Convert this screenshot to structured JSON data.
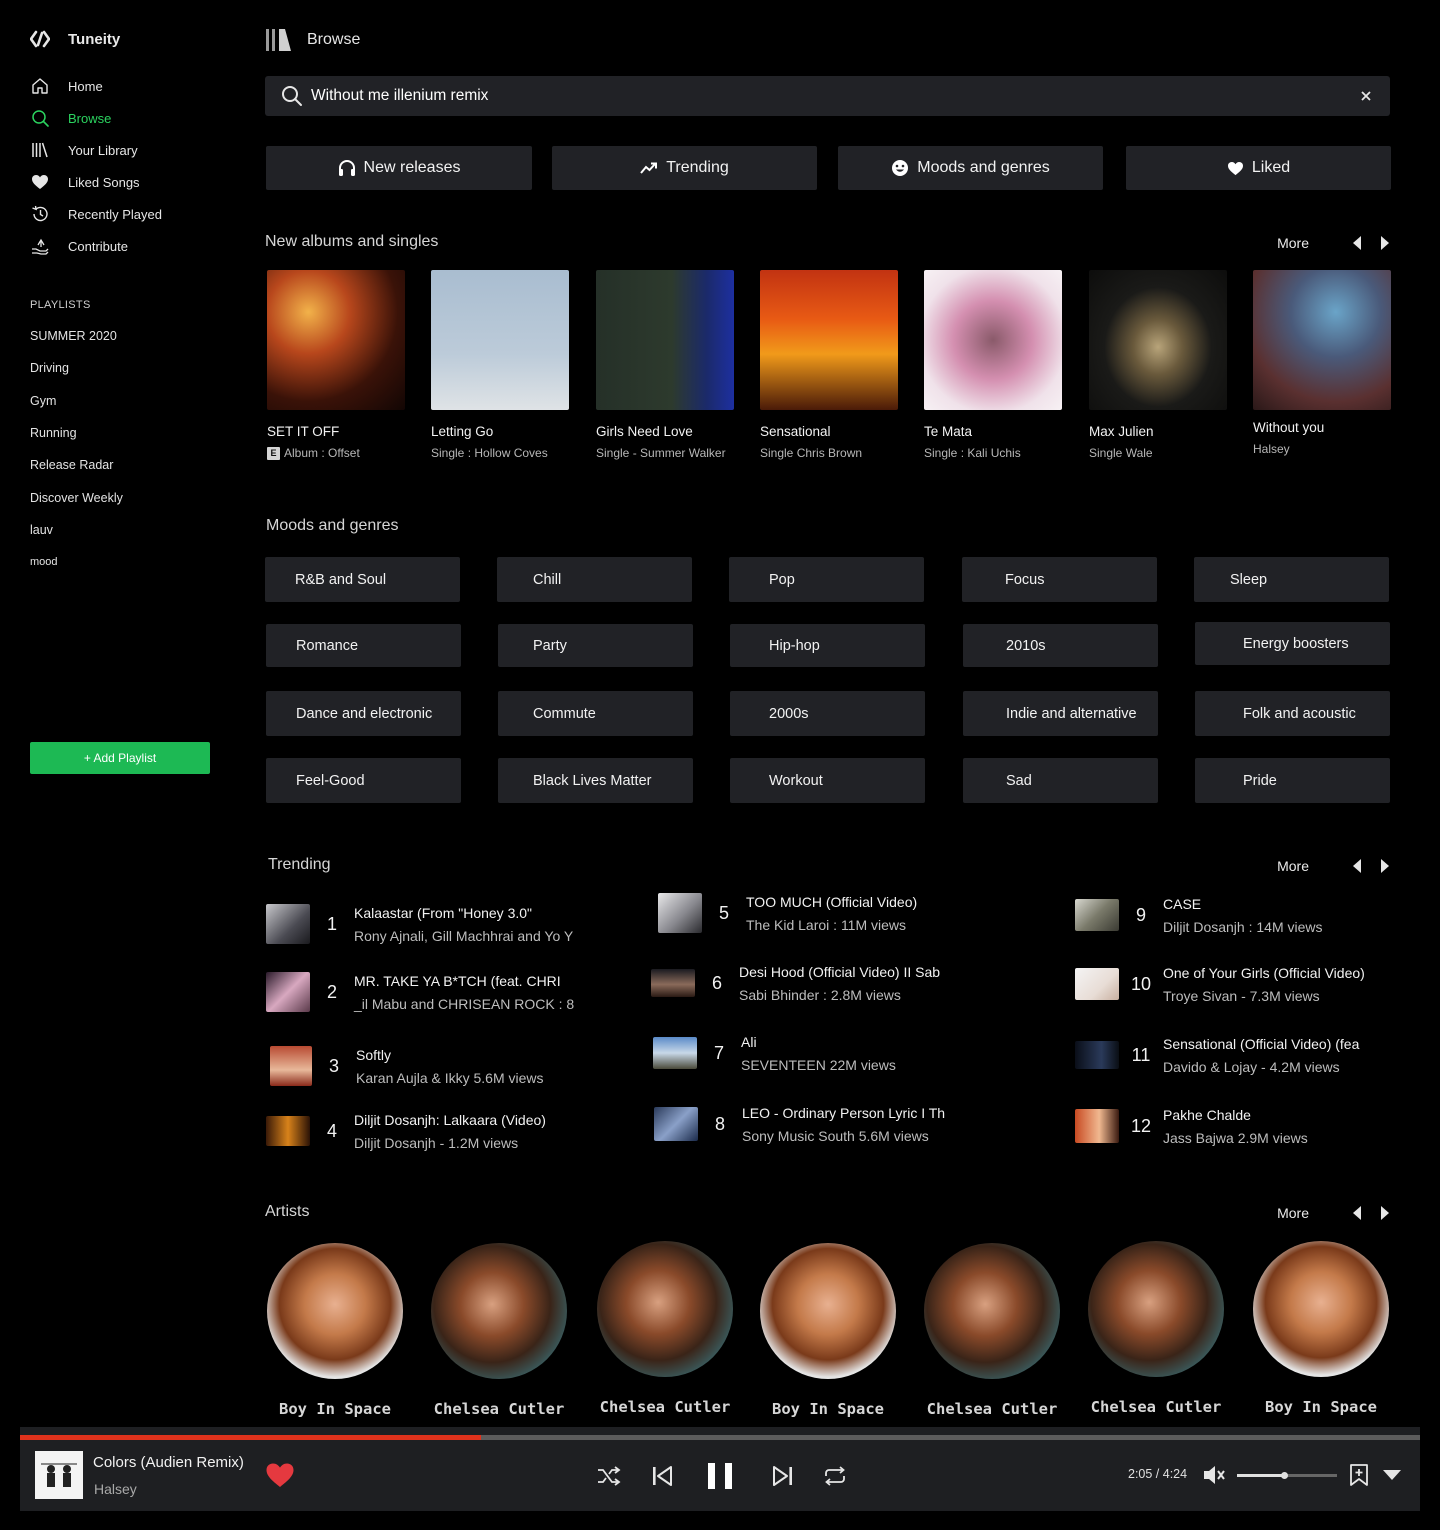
{
  "app": {
    "name": "Tuneity"
  },
  "nav": [
    {
      "label": "Home",
      "icon": "home-icon",
      "active": false
    },
    {
      "label": "Browse",
      "icon": "search-icon",
      "active": true
    },
    {
      "label": "Your Library",
      "icon": "library-icon",
      "active": false
    },
    {
      "label": "Liked Songs",
      "icon": "heart-icon",
      "active": false
    },
    {
      "label": "Recently Played",
      "icon": "history-icon",
      "active": false
    },
    {
      "label": "Contribute",
      "icon": "contribute-icon",
      "active": false
    }
  ],
  "playlists": {
    "heading": "PLAYLISTS",
    "items": [
      "SUMMER 2020",
      "Driving",
      "Gym",
      "Running",
      "Release Radar",
      "Discover Weekly",
      "lauv",
      "mood"
    ],
    "add_label": "+ Add Playlist"
  },
  "page": {
    "title": "Browse"
  },
  "search": {
    "value": "Without me illenium remix"
  },
  "quick_links": [
    {
      "label": "New releases",
      "icon": "headphones-icon"
    },
    {
      "label": "Trending",
      "icon": "trending-icon"
    },
    {
      "label": "Moods and genres",
      "icon": "smiley-icon"
    },
    {
      "label": "Liked",
      "icon": "heart-icon"
    }
  ],
  "new_albums": {
    "title": "New albums and singles",
    "more": "More",
    "items": [
      {
        "name": "SET IT OFF",
        "meta": "Album : Offset",
        "explicit": true
      },
      {
        "name": "Letting Go",
        "meta": "Single : Hollow Coves",
        "explicit": false
      },
      {
        "name": "Girls Need Love",
        "meta": "Single - Summer Walker",
        "explicit": false
      },
      {
        "name": "Sensational",
        "meta": "Single  Chris Brown",
        "explicit": false
      },
      {
        "name": "Te Mata",
        "meta": "Single : Kali Uchis",
        "explicit": false
      },
      {
        "name": "Max Julien",
        "meta": "Single  Wale",
        "explicit": false
      },
      {
        "name": "Without you",
        "meta": "Halsey",
        "explicit": false
      }
    ]
  },
  "moods": {
    "title": "Moods and genres",
    "items": [
      "R&B and Soul",
      "Chill",
      "Pop",
      "Focus",
      "Sleep",
      "Romance",
      "Party",
      "Hip-hop",
      "2010s",
      "Energy boosters",
      "Dance and electronic",
      "Commute",
      "2000s",
      "Indie and alternative",
      "Folk and acoustic",
      "Feel-Good",
      "Black Lives Matter",
      "Workout",
      "Sad",
      "Pride"
    ]
  },
  "trending": {
    "title": "Trending",
    "more": "More",
    "items": [
      {
        "rank": "1",
        "title": "Kalaastar (From \"Honey 3.0\"",
        "sub": "Rony Ajnali, Gill Machhrai and Yo Y"
      },
      {
        "rank": "2",
        "title": "MR. TAKE YA B*TCH (feat. CHRI",
        "sub": "_il Mabu and CHRISEAN ROCK : 8"
      },
      {
        "rank": "3",
        "title": "Softly",
        "sub": "Karan Aujla & Ikky  5.6M views"
      },
      {
        "rank": "4",
        "title": "Diljit Dosanjh: Lalkaara (Video)",
        "sub": "Diljit Dosanjh - 1.2M views"
      },
      {
        "rank": "5",
        "title": "TOO MUCH (Official Video)",
        "sub": "The Kid Laroi : 11M views"
      },
      {
        "rank": "6",
        "title": "Desi Hood (Official Video) II Sab",
        "sub": "Sabi Bhinder : 2.8M views"
      },
      {
        "rank": "7",
        "title": "Ali",
        "sub": "SEVENTEEN  22M views"
      },
      {
        "rank": "8",
        "title": "LEO - Ordinary Person Lyric I Th",
        "sub": "Sony Music South  5.6M views"
      },
      {
        "rank": "9",
        "title": "CASE",
        "sub": "Diljit Dosanjh : 14M views"
      },
      {
        "rank": "10",
        "title": "One of Your Girls (Official Video)",
        "sub": "Troye Sivan - 7.3M views"
      },
      {
        "rank": "11",
        "title": "Sensational (Official Video) (fea",
        "sub": "Davido & Lojay - 4.2M views"
      },
      {
        "rank": "12",
        "title": "Pakhe Chalde",
        "sub": "Jass Bajwa  2.9M views"
      }
    ]
  },
  "artists": {
    "title": "Artists",
    "more": "More",
    "items": [
      "Boy In Space",
      "Chelsea Cutler",
      "Chelsea Cutler",
      "Boy In Space",
      "Chelsea Cutler",
      "Chelsea Cutler",
      "Boy In Space"
    ]
  },
  "player": {
    "title": "Colors (Audien Remix)",
    "artist": "Halsey",
    "time": "2:05 / 4:24",
    "progress": 0.329,
    "volume": 0.47,
    "liked": true,
    "accent": "#e0321c"
  },
  "colors": {
    "brand": "#1db954",
    "active": "#2bd35f",
    "panel": "#212226",
    "heart": "#e5393f"
  }
}
